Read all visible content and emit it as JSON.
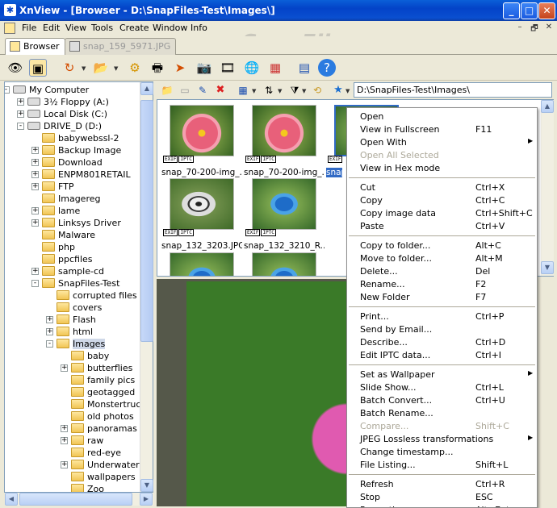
{
  "window": {
    "title": "XnView - [Browser - D:\\SnapFiles-Test\\Images\\]",
    "app_icon": "xnview-logo-icon",
    "min": "_",
    "max": "□",
    "close": "✕"
  },
  "menu": {
    "items": [
      "File",
      "Edit",
      "View",
      "Tools",
      "Create",
      "Window",
      "Info"
    ],
    "mdi_buttons": [
      "–",
      "🗗",
      "✕"
    ]
  },
  "watermark": "SnapFiles",
  "tabs": [
    {
      "label": "Browser",
      "active": true
    },
    {
      "label": "snap_159_5971.JPG",
      "active": false
    }
  ],
  "toolbar": {
    "icons": [
      "eye-icon",
      "browser-icon",
      "rotate-icon",
      "folder-icon",
      "settings-icon",
      "print-icon",
      "send-icon",
      "camera-icon",
      "filmstrip-icon",
      "globe-icon",
      "palette-icon",
      "book-icon",
      "help-icon"
    ]
  },
  "tree": {
    "items": [
      {
        "label": "My Computer",
        "depth": 0,
        "exp": "-",
        "kind": "computer"
      },
      {
        "label": "3½ Floppy (A:)",
        "depth": 1,
        "exp": "+",
        "kind": "drive"
      },
      {
        "label": "Local Disk (C:)",
        "depth": 1,
        "exp": "+",
        "kind": "drive"
      },
      {
        "label": "DRIVE_D (D:)",
        "depth": 1,
        "exp": "-",
        "kind": "drive"
      },
      {
        "label": "babywebssl-2",
        "depth": 2,
        "exp": "",
        "kind": "folder"
      },
      {
        "label": "Backup Image",
        "depth": 2,
        "exp": "+",
        "kind": "folder"
      },
      {
        "label": "Download",
        "depth": 2,
        "exp": "+",
        "kind": "folder"
      },
      {
        "label": "ENPM801RETAIL",
        "depth": 2,
        "exp": "+",
        "kind": "folder"
      },
      {
        "label": "FTP",
        "depth": 2,
        "exp": "+",
        "kind": "folder"
      },
      {
        "label": "Imagereg",
        "depth": 2,
        "exp": "",
        "kind": "folder"
      },
      {
        "label": "lame",
        "depth": 2,
        "exp": "+",
        "kind": "folder"
      },
      {
        "label": "Linksys Driver",
        "depth": 2,
        "exp": "+",
        "kind": "folder"
      },
      {
        "label": "Malware",
        "depth": 2,
        "exp": "",
        "kind": "folder"
      },
      {
        "label": "php",
        "depth": 2,
        "exp": "",
        "kind": "folder"
      },
      {
        "label": "ppcfiles",
        "depth": 2,
        "exp": "",
        "kind": "folder"
      },
      {
        "label": "sample-cd",
        "depth": 2,
        "exp": "+",
        "kind": "folder"
      },
      {
        "label": "SnapFiles-Test",
        "depth": 2,
        "exp": "-",
        "kind": "folder"
      },
      {
        "label": "corrupted files",
        "depth": 3,
        "exp": "",
        "kind": "folder"
      },
      {
        "label": "covers",
        "depth": 3,
        "exp": "",
        "kind": "folder"
      },
      {
        "label": "Flash",
        "depth": 3,
        "exp": "+",
        "kind": "folder"
      },
      {
        "label": "html",
        "depth": 3,
        "exp": "+",
        "kind": "folder"
      },
      {
        "label": "Images",
        "depth": 3,
        "exp": "-",
        "kind": "folder",
        "selected": true
      },
      {
        "label": "baby",
        "depth": 4,
        "exp": "",
        "kind": "folder"
      },
      {
        "label": "butterflies",
        "depth": 4,
        "exp": "+",
        "kind": "folder"
      },
      {
        "label": "family pics",
        "depth": 4,
        "exp": "",
        "kind": "folder"
      },
      {
        "label": "geotagged",
        "depth": 4,
        "exp": "",
        "kind": "folder"
      },
      {
        "label": "Monstertruc",
        "depth": 4,
        "exp": "",
        "kind": "folder"
      },
      {
        "label": "old photos",
        "depth": 4,
        "exp": "",
        "kind": "folder"
      },
      {
        "label": "panoramas",
        "depth": 4,
        "exp": "+",
        "kind": "folder"
      },
      {
        "label": "raw",
        "depth": 4,
        "exp": "+",
        "kind": "folder"
      },
      {
        "label": "red-eye",
        "depth": 4,
        "exp": "",
        "kind": "folder"
      },
      {
        "label": "Underwater",
        "depth": 4,
        "exp": "+",
        "kind": "folder"
      },
      {
        "label": "wallpapers",
        "depth": 4,
        "exp": "",
        "kind": "folder"
      },
      {
        "label": "Zoo",
        "depth": 4,
        "exp": "",
        "kind": "folder"
      }
    ]
  },
  "path": "D:\\SnapFiles-Test\\Images\\",
  "thumbnails": [
    {
      "caption": "snap_70-200-img_...",
      "kind": "flower",
      "badges": [
        "EXIF",
        "IPTC"
      ]
    },
    {
      "caption": "snap_70-200-img_...",
      "kind": "flower",
      "badges": [
        "EXIF",
        "IPTC"
      ]
    },
    {
      "caption": "snap",
      "kind": "blue",
      "badges": [
        "EXIF"
      ]
    },
    {
      "caption": "snap_132_3203.JPG",
      "kind": "butterfly",
      "badges": [
        "EXIF",
        "IPTC"
      ]
    },
    {
      "caption": "snap_132_3210_R...",
      "kind": "blue",
      "badges": [
        "EXIF",
        "IPTC"
      ]
    },
    {
      "caption": "",
      "kind": "blue",
      "badges": []
    },
    {
      "caption": "",
      "kind": "blue",
      "badges": []
    }
  ],
  "context_menu": {
    "items": [
      {
        "label": "Open",
        "shortcut": ""
      },
      {
        "label": "View in Fullscreen",
        "shortcut": "F11"
      },
      {
        "label": "Open With",
        "shortcut": "",
        "submenu": true
      },
      {
        "label": "Open All Selected",
        "shortcut": "",
        "disabled": true
      },
      {
        "label": "View in Hex mode",
        "shortcut": ""
      },
      {
        "sep": true
      },
      {
        "label": "Cut",
        "shortcut": "Ctrl+X"
      },
      {
        "label": "Copy",
        "shortcut": "Ctrl+C"
      },
      {
        "label": "Copy image data",
        "shortcut": "Ctrl+Shift+C"
      },
      {
        "label": "Paste",
        "shortcut": "Ctrl+V"
      },
      {
        "sep": true
      },
      {
        "label": "Copy to folder...",
        "shortcut": "Alt+C"
      },
      {
        "label": "Move to folder...",
        "shortcut": "Alt+M"
      },
      {
        "label": "Delete...",
        "shortcut": "Del"
      },
      {
        "label": "Rename...",
        "shortcut": "F2"
      },
      {
        "label": "New Folder",
        "shortcut": "F7"
      },
      {
        "sep": true
      },
      {
        "label": "Print...",
        "shortcut": "Ctrl+P"
      },
      {
        "label": "Send by Email...",
        "shortcut": ""
      },
      {
        "label": "Describe...",
        "shortcut": "Ctrl+D"
      },
      {
        "label": "Edit IPTC data...",
        "shortcut": "Ctrl+I"
      },
      {
        "sep": true
      },
      {
        "label": "Set as Wallpaper",
        "shortcut": "",
        "submenu": true
      },
      {
        "label": "Slide Show...",
        "shortcut": "Ctrl+L"
      },
      {
        "label": "Batch Convert...",
        "shortcut": "Ctrl+U"
      },
      {
        "label": "Batch Rename...",
        "shortcut": ""
      },
      {
        "label": "Compare...",
        "shortcut": "Shift+C",
        "disabled": true
      },
      {
        "label": "JPEG Lossless transformations",
        "shortcut": "",
        "submenu": true
      },
      {
        "label": "Change timestamp...",
        "shortcut": ""
      },
      {
        "label": "File Listing...",
        "shortcut": "Shift+L"
      },
      {
        "sep": true
      },
      {
        "label": "Refresh",
        "shortcut": "Ctrl+R"
      },
      {
        "label": "Stop",
        "shortcut": "ESC"
      },
      {
        "label": "Properties",
        "shortcut": "Alt+Enter"
      }
    ]
  }
}
